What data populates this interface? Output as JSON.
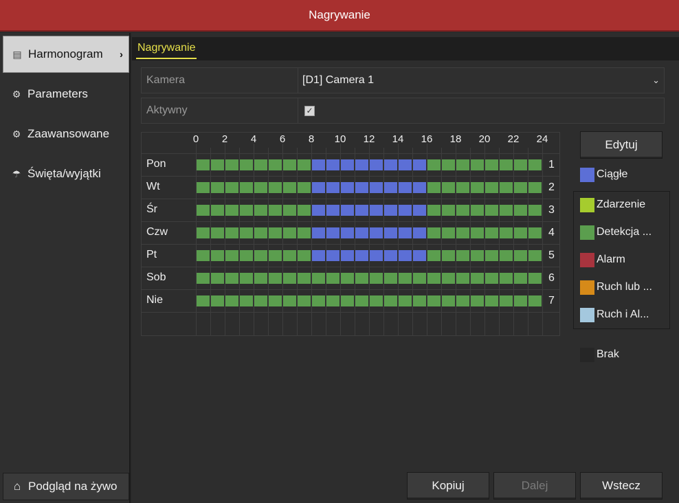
{
  "window": {
    "title": "Nagrywanie"
  },
  "sidebar": {
    "items": [
      {
        "label": "Harmonogram",
        "icon": "calendar-icon",
        "active": true
      },
      {
        "label": "Parameters",
        "icon": "gear-icon",
        "active": false
      },
      {
        "label": "Zaawansowane",
        "icon": "advanced-gear-icon",
        "active": false
      },
      {
        "label": "Święta/wyjątki",
        "icon": "umbrella-icon",
        "active": false
      }
    ],
    "live_view": {
      "label": "Podgląd na żywo",
      "icon": "home-icon"
    }
  },
  "tabs": [
    {
      "label": "Nagrywanie",
      "active": true
    }
  ],
  "form": {
    "camera": {
      "label": "Kamera",
      "value": "[D1] Camera 1"
    },
    "enabled": {
      "label": "Aktywny",
      "checked": true
    }
  },
  "schedule": {
    "hour_labels": [
      "0",
      "2",
      "4",
      "6",
      "8",
      "10",
      "12",
      "14",
      "16",
      "18",
      "20",
      "22",
      "24"
    ],
    "days": [
      {
        "label": "Pon",
        "number": "1",
        "segments": [
          {
            "type": "detekcja",
            "from": 0,
            "to": 8
          },
          {
            "type": "ciagle",
            "from": 8,
            "to": 16
          },
          {
            "type": "detekcja",
            "from": 16,
            "to": 24
          }
        ]
      },
      {
        "label": "Wt",
        "number": "2",
        "segments": [
          {
            "type": "detekcja",
            "from": 0,
            "to": 8
          },
          {
            "type": "ciagle",
            "from": 8,
            "to": 16
          },
          {
            "type": "detekcja",
            "from": 16,
            "to": 24
          }
        ]
      },
      {
        "label": "Śr",
        "number": "3",
        "segments": [
          {
            "type": "detekcja",
            "from": 0,
            "to": 8
          },
          {
            "type": "ciagle",
            "from": 8,
            "to": 16
          },
          {
            "type": "detekcja",
            "from": 16,
            "to": 24
          }
        ]
      },
      {
        "label": "Czw",
        "number": "4",
        "segments": [
          {
            "type": "detekcja",
            "from": 0,
            "to": 8
          },
          {
            "type": "ciagle",
            "from": 8,
            "to": 16
          },
          {
            "type": "detekcja",
            "from": 16,
            "to": 24
          }
        ]
      },
      {
        "label": "Pt",
        "number": "5",
        "segments": [
          {
            "type": "detekcja",
            "from": 0,
            "to": 8
          },
          {
            "type": "ciagle",
            "from": 8,
            "to": 16
          },
          {
            "type": "detekcja",
            "from": 16,
            "to": 24
          }
        ]
      },
      {
        "label": "Sob",
        "number": "6",
        "segments": [
          {
            "type": "detekcja",
            "from": 0,
            "to": 24
          }
        ]
      },
      {
        "label": "Nie",
        "number": "7",
        "segments": [
          {
            "type": "detekcja",
            "from": 0,
            "to": 24
          }
        ]
      }
    ]
  },
  "legend": {
    "items": [
      {
        "key": "ciagle",
        "label": "Ciągłe",
        "color": "#5c6fd6"
      },
      {
        "key": "zdarzenie",
        "label": "Zdarzenie",
        "color": "#a6cc2e"
      },
      {
        "key": "detekcja",
        "label": "Detekcja ...",
        "color": "#5b9e4e"
      },
      {
        "key": "alarm",
        "label": "Alarm",
        "color": "#a8343e"
      },
      {
        "key": "ruch_lub",
        "label": "Ruch lub ...",
        "color": "#d68a19"
      },
      {
        "key": "ruch_i",
        "label": "Ruch i Al...",
        "color": "#a4c8de"
      },
      {
        "key": "brak",
        "label": "Brak",
        "color": "#262626"
      }
    ]
  },
  "buttons": {
    "edit": "Edytuj",
    "copy": "Kopiuj",
    "next": "Dalej",
    "back": "Wstecz"
  }
}
